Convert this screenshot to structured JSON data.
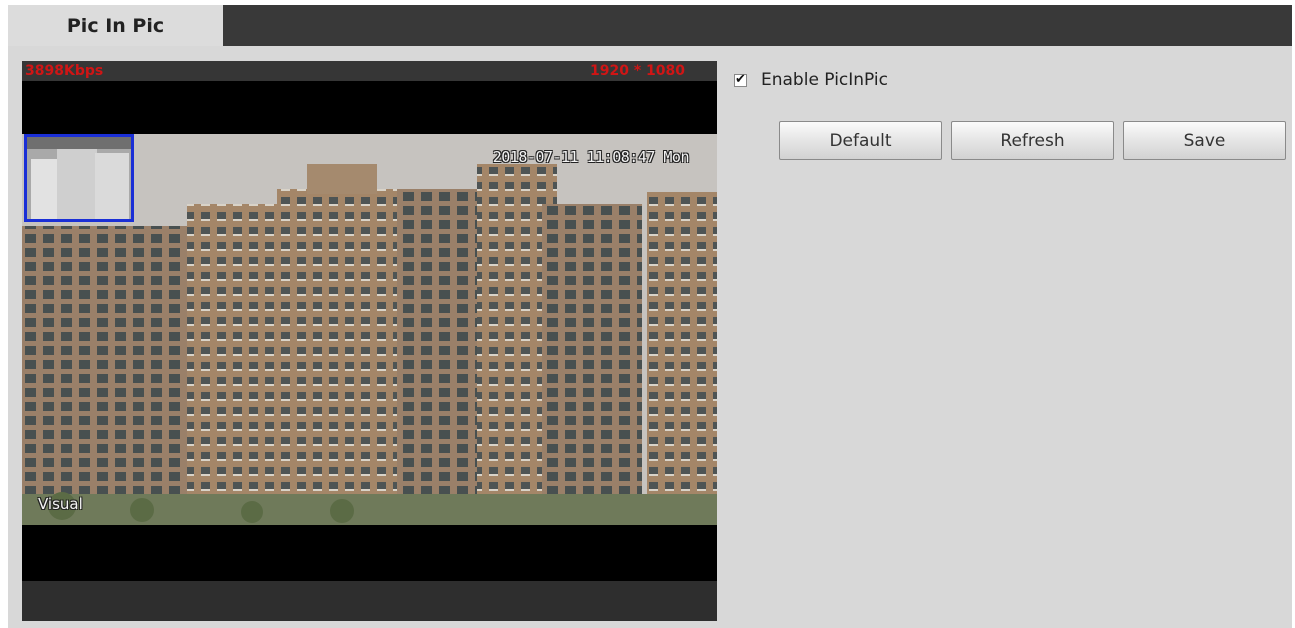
{
  "tabs": [
    {
      "label": "Pic In Pic",
      "active": true
    }
  ],
  "video": {
    "bitrate": "3898Kbps",
    "resolution": "1920 * 1080",
    "timestamp": "2018-07-11 11:08:47 Mon",
    "channel_label": "Visual"
  },
  "options": {
    "enable_label": "Enable PicInPic",
    "enable_checked": true
  },
  "buttons": {
    "default_label": "Default",
    "refresh_label": "Refresh",
    "save_label": "Save"
  },
  "colors": {
    "tab_bar": "#393939",
    "panel_bg": "#d8d8d8",
    "overlay_red": "#d01515",
    "pip_border": "#1a2fd6"
  }
}
